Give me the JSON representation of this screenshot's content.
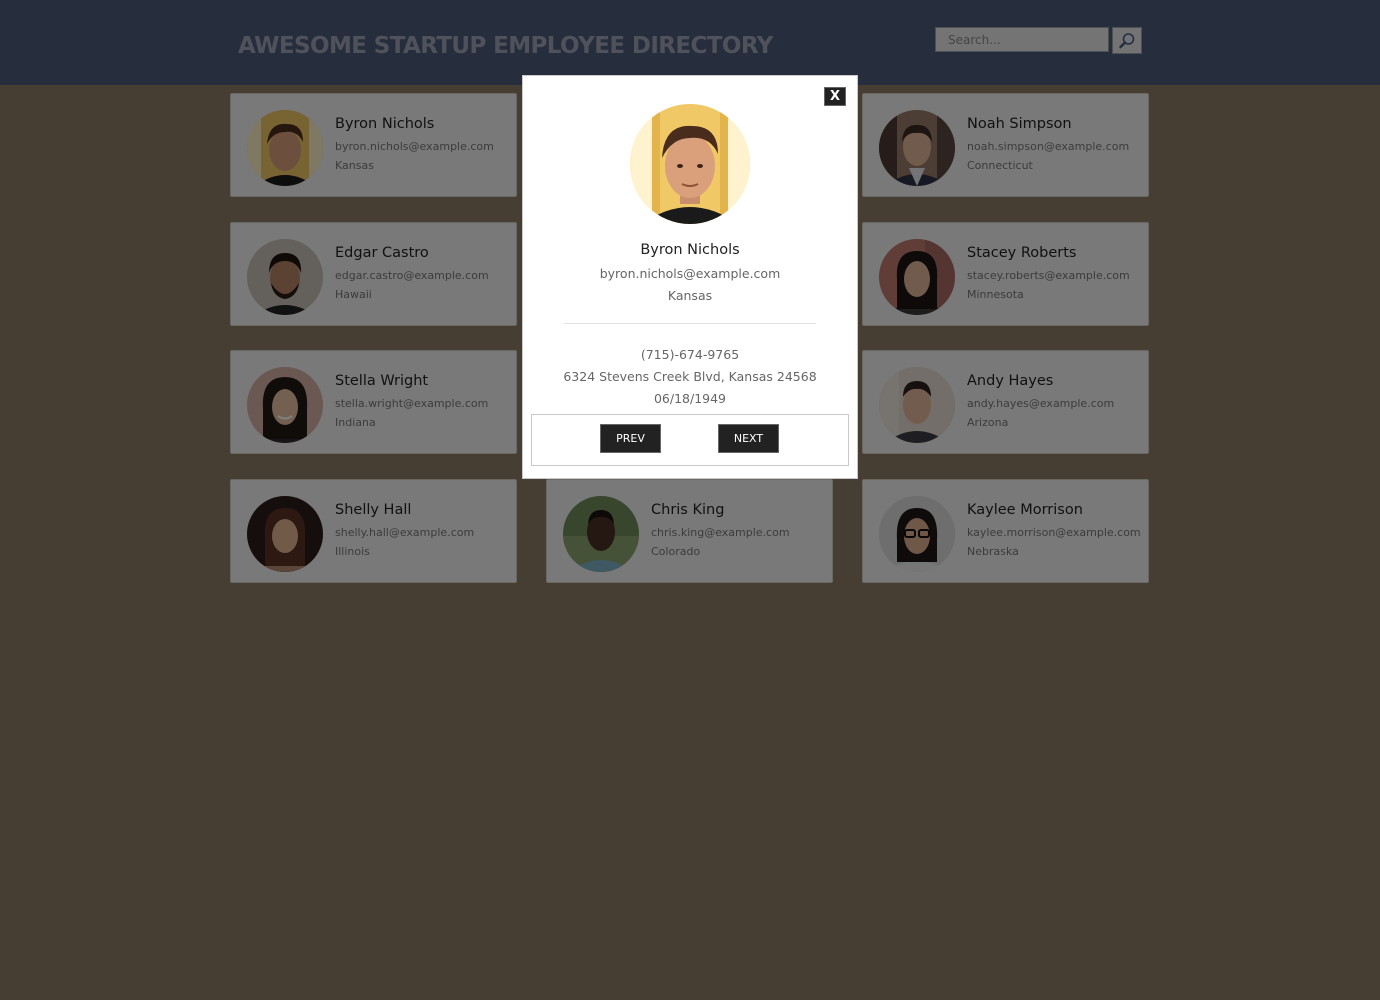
{
  "header": {
    "title": "AWESOME STARTUP EMPLOYEE DIRECTORY",
    "search": {
      "placeholder": "Search...",
      "value": ""
    },
    "search_icon": "magnifier-icon"
  },
  "employees": [
    {
      "name": "Byron Nichols",
      "email": "byron.nichols@example.com",
      "location": "Kansas",
      "photo": "photo-byron"
    },
    {
      "name": "Noah Simpson",
      "email": "noah.simpson@example.com",
      "location": "Connecticut",
      "photo": "photo-noah"
    },
    {
      "name": "Edgar Castro",
      "email": "edgar.castro@example.com",
      "location": "Hawaii",
      "photo": "photo-edgar"
    },
    {
      "name": "Stacey Roberts",
      "email": "stacey.roberts@example.com",
      "location": "Minnesota",
      "photo": "photo-stacey"
    },
    {
      "name": "Stella Wright",
      "email": "stella.wright@example.com",
      "location": "Indiana",
      "photo": "photo-stella"
    },
    {
      "name": "Andy Hayes",
      "email": "andy.hayes@example.com",
      "location": "Arizona",
      "photo": "photo-andy"
    },
    {
      "name": "Shelly Hall",
      "email": "shelly.hall@example.com",
      "location": "Illinois",
      "photo": "photo-shelly"
    },
    {
      "name": "Chris King",
      "email": "chris.king@example.com",
      "location": "Colorado",
      "photo": "photo-chris"
    },
    {
      "name": "Kaylee Morrison",
      "email": "kaylee.morrison@example.com",
      "location": "Nebraska",
      "photo": "photo-kaylee"
    }
  ],
  "modal": {
    "close_label": "X",
    "name": "Byron Nichols",
    "email": "byron.nichols@example.com",
    "location": "Kansas",
    "phone": "(715)-674-9765",
    "address": "6324 Stevens Creek Blvd, Kansas 24568",
    "birthday": "06/18/1949",
    "prev_label": "PREV",
    "next_label": "NEXT"
  },
  "colors": {
    "header_bg": "#4c5a7a",
    "page_bg": "#8d7a66",
    "card_bg": "#f3f3f3",
    "button_bg": "#222222"
  }
}
